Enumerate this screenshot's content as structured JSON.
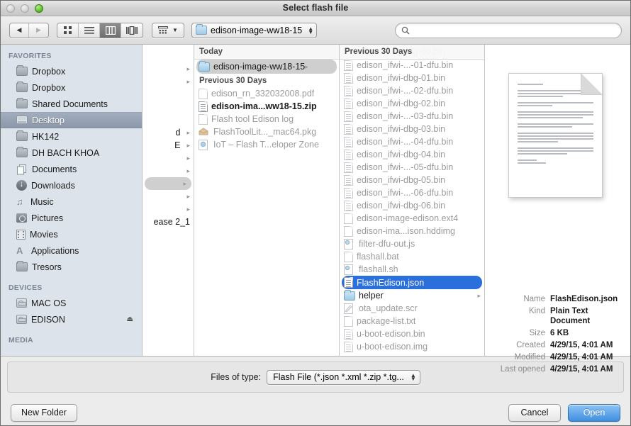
{
  "window": {
    "title": "Select flash file",
    "traffic_lights": [
      "close-button",
      "minimize-button",
      "zoom-button"
    ]
  },
  "toolbar": {
    "back_icon": "◀",
    "forward_icon": "▶",
    "view_buttons": [
      {
        "name": "icon-view",
        "label": "icon-grid-icon"
      },
      {
        "name": "list-view",
        "label": "list-icon"
      },
      {
        "name": "column-view",
        "label": "column-icon",
        "selected": true
      },
      {
        "name": "coverflow-view",
        "label": "coverflow-icon"
      }
    ],
    "action_menu": "gear-action-icon",
    "path_button": "edison-image-ww18-15",
    "search_placeholder": "",
    "search_value": ""
  },
  "sidebar": {
    "sections": [
      {
        "header": "FAVORITES",
        "items": [
          {
            "label": "Dropbox",
            "icon": "folder-icon"
          },
          {
            "label": "Dropbox",
            "icon": "folder-icon"
          },
          {
            "label": "Shared Documents",
            "icon": "folder-icon"
          },
          {
            "label": "Desktop",
            "icon": "desktop-icon",
            "selected": true
          },
          {
            "label": "HK142",
            "icon": "folder-icon"
          },
          {
            "label": "DH BACH KHOA",
            "icon": "folder-icon"
          },
          {
            "label": "Documents",
            "icon": "documents-icon"
          },
          {
            "label": "Downloads",
            "icon": "downloads-icon"
          },
          {
            "label": "Music",
            "icon": "music-note-icon"
          },
          {
            "label": "Pictures",
            "icon": "camera-icon"
          },
          {
            "label": "Movies",
            "icon": "film-icon"
          },
          {
            "label": "Applications",
            "icon": "applications-icon"
          },
          {
            "label": "Tresors",
            "icon": "folder-icon"
          }
        ]
      },
      {
        "header": "DEVICES",
        "items": [
          {
            "label": "MAC OS",
            "icon": "hard-drive-icon"
          },
          {
            "label": "EDISON",
            "icon": "hard-drive-icon",
            "eject": "⏏"
          }
        ]
      },
      {
        "header": "MEDIA",
        "items": []
      }
    ]
  },
  "column1": {
    "rows": [
      {
        "label": "",
        "arrow": "▸"
      },
      {
        "label": "",
        "arrow": "▸"
      },
      {
        "label": "d",
        "arrow": "▸"
      },
      {
        "label": "E",
        "arrow": "▸"
      },
      {
        "label": "",
        "arrow": "▸"
      },
      {
        "label": "",
        "arrow": "▸"
      },
      {
        "label": "",
        "arrow": "▸",
        "selected": true
      },
      {
        "label": "",
        "arrow": "▸"
      },
      {
        "label": "",
        "arrow": "▸"
      },
      {
        "label": "ease 2_1",
        "arrow": ""
      }
    ]
  },
  "column2": {
    "header": "Today",
    "rows": [
      {
        "label": "edison-image-ww18-15",
        "icon": "folder-blue-icon",
        "selected": true,
        "arrow": "▸"
      },
      {
        "label": "Previous 30 Days",
        "is_header": true
      },
      {
        "label": "edison_rn_332032008.pdf",
        "icon": "pdf-document-icon",
        "disabled": true
      },
      {
        "label": "edison-ima...ww18-15.zip",
        "icon": "zip-document-icon",
        "bold": true
      },
      {
        "label": "Flash tool Edison log",
        "icon": "blank-document-icon",
        "disabled": true
      },
      {
        "label": "FlashToolLit..._mac64.pkg",
        "icon": "package-icon",
        "disabled": true
      },
      {
        "label": "IoT – Flash T...eloper Zone",
        "icon": "webloc-document-icon",
        "disabled": true
      }
    ]
  },
  "column3": {
    "sticky_header": "Previous 30 Days",
    "scrolled_row": "edison_ifwi-dbg-00.bin",
    "rows": [
      {
        "label": "edison_ifwi-...-01-dfu.bin",
        "icon": "bin-document-icon",
        "disabled": true
      },
      {
        "label": "edison_ifwi-dbg-01.bin",
        "icon": "bin-document-icon",
        "disabled": true
      },
      {
        "label": "edison_ifwi-...-02-dfu.bin",
        "icon": "bin-document-icon",
        "disabled": true
      },
      {
        "label": "edison_ifwi-dbg-02.bin",
        "icon": "bin-document-icon",
        "disabled": true
      },
      {
        "label": "edison_ifwi-...-03-dfu.bin",
        "icon": "bin-document-icon",
        "disabled": true
      },
      {
        "label": "edison_ifwi-dbg-03.bin",
        "icon": "bin-document-icon",
        "disabled": true
      },
      {
        "label": "edison_ifwi-...-04-dfu.bin",
        "icon": "bin-document-icon",
        "disabled": true
      },
      {
        "label": "edison_ifwi-dbg-04.bin",
        "icon": "bin-document-icon",
        "disabled": true
      },
      {
        "label": "edison_ifwi-...-05-dfu.bin",
        "icon": "bin-document-icon",
        "disabled": true
      },
      {
        "label": "edison_ifwi-dbg-05.bin",
        "icon": "bin-document-icon",
        "disabled": true
      },
      {
        "label": "edison_ifwi-...-06-dfu.bin",
        "icon": "bin-document-icon",
        "disabled": true
      },
      {
        "label": "edison_ifwi-dbg-06.bin",
        "icon": "bin-document-icon",
        "disabled": true
      },
      {
        "label": "edison-image-edison.ext4",
        "icon": "blank-document-icon",
        "disabled": true
      },
      {
        "label": "edison-ima...ison.hddimg",
        "icon": "blank-document-icon",
        "disabled": true
      },
      {
        "label": "filter-dfu-out.js",
        "icon": "script-document-icon",
        "disabled": true
      },
      {
        "label": "flashall.bat",
        "icon": "blank-document-icon",
        "disabled": true
      },
      {
        "label": "flashall.sh",
        "icon": "script-document-icon",
        "disabled": true
      },
      {
        "label": "FlashEdison.json",
        "icon": "json-document-icon",
        "selected": true
      },
      {
        "label": "helper",
        "icon": "folder-icon",
        "arrow": "▸"
      },
      {
        "label": "ota_update.scr",
        "icon": "scr-document-icon",
        "disabled": true
      },
      {
        "label": "package-list.txt",
        "icon": "text-document-icon",
        "disabled": true
      },
      {
        "label": "u-boot-edison.bin",
        "icon": "bin-document-icon",
        "disabled": true
      },
      {
        "label": "u-boot-edison.img",
        "icon": "img-document-icon",
        "disabled": true
      }
    ]
  },
  "preview": {
    "icon": "plain-text-document-preview",
    "metadata": [
      {
        "key": "Name",
        "value": "FlashEdison.json"
      },
      {
        "key": "Kind",
        "value": "Plain Text Document"
      },
      {
        "key": "Size",
        "value": "6 KB"
      },
      {
        "key": "Created",
        "value": "4/29/15, 4:01 AM"
      },
      {
        "key": "Modified",
        "value": "4/29/15, 4:01 AM"
      },
      {
        "key": "Last opened",
        "value": "4/29/15, 4:01 AM"
      }
    ]
  },
  "footer": {
    "filter_label": "Files of type:",
    "filter_value": "Flash File (*.json *.xml *.zip *.tg...",
    "new_folder_label": "New Folder",
    "cancel_label": "Cancel",
    "open_label": "Open"
  },
  "colors": {
    "selection_blue": "#2a6fdb",
    "sidebar_selection": "#8c99ab",
    "sidebar_bg": "#dde3ea",
    "primary_button": "#3f8fe0"
  }
}
